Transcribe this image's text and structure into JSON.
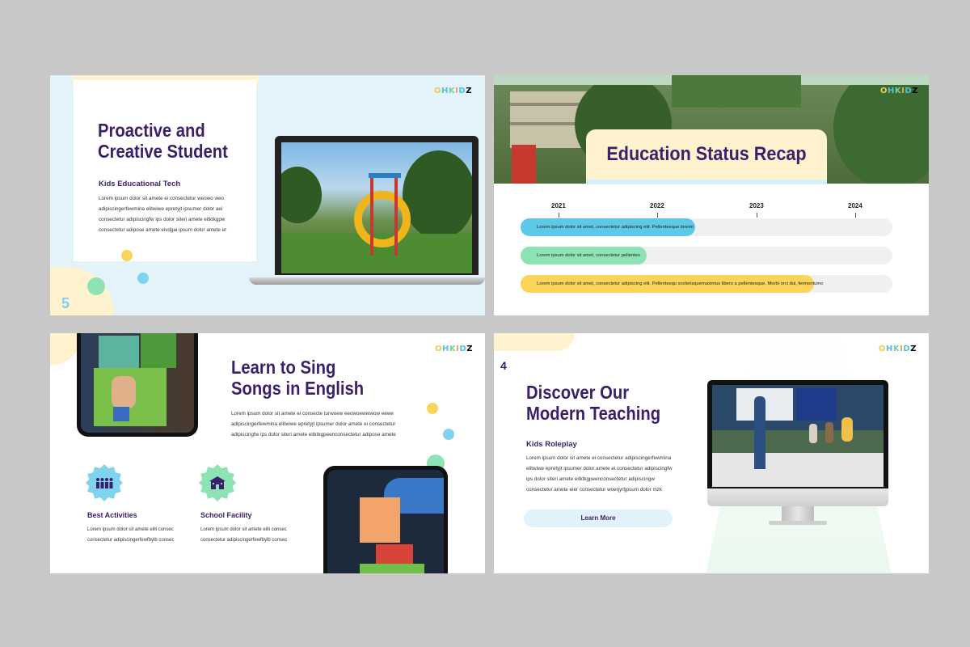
{
  "brand": [
    "O",
    "H",
    "K",
    "I",
    "D",
    "Z"
  ],
  "slide1": {
    "title_line1": "Proactive and",
    "title_line2": "Creative Student",
    "subtitle": "Kids Educational Tech",
    "body": "Lorem ipsum dolor sit amete ei consectetur weowo weo adipiscingerfewmina elitwiwe epretyjt ipsumer dolor aei consectetur adipiscingfw ips dolor siteri amete eitktkgpw consectetur adipose amete eivdgai ipsum dolor amete er",
    "page_number": "5"
  },
  "slide2": {
    "title": "Education Status Recap",
    "years": [
      "2021",
      "2022",
      "2023",
      "2024"
    ],
    "bars": [
      {
        "text": "Lorem ipsum dolor sit amet, consectetur adipiscing elit. Pellentesque loremi",
        "progress": 0.47,
        "color": "#5ec9e6"
      },
      {
        "text": "Lorem ipsum dolor sit amet, consectetur pellentes",
        "progress": 0.34,
        "color": "#8ee3b4"
      },
      {
        "text": "Lorem ipsum dolor sit amet, consectetur adipiscing elit. Pellentesqu scelerisquemaximus libero a pellentesque. Morbi orci dui, fermentumo",
        "progress": 0.79,
        "color": "#fbd45a"
      }
    ]
  },
  "slide3": {
    "title_line1": "Learn to Sing",
    "title_line2": "Songs in English",
    "body": "Lorem ipsum dolor sit amete ei consecte turwoew eeowoeweiwow eewe adipiscingerfewmina elitwiwe epretyjt ipsumer dolor amete ei consectetur adipiscingfw ips dolor siteri amete eitktkgpeenconsectetur adipose amete",
    "feature1": {
      "title": "Best Activities",
      "body": "Lorem ipsum dolor sit amete eilli consec consectetur adipiscingerfewfbylb consec",
      "icon": "group-icon",
      "color": "#7fd3ef"
    },
    "feature2": {
      "title": "School Facility",
      "body": "Lorem ipsum dolor sit amete eilli consec consectetur adipiscingerfewfbylb consec",
      "icon": "school-icon",
      "color": "#8ee3b4"
    }
  },
  "slide4": {
    "title_line1": "Discover Our",
    "title_line2": "Modern Teaching",
    "subtitle": "Kids Roleplay",
    "body": "Lorem ipsum dolor sit amete ei consectetur adipiscingerfewmina elitwiwe epretyjt ipsumer dolor amete ei consectetur adipiscingfw ips dolor siteri amete eitktkgpeenconsectetur adipiscingw consectetur amete eier consectetur woerjyrtjpsum dolor mzk",
    "button_label": "Learn More",
    "page_number": "4"
  }
}
